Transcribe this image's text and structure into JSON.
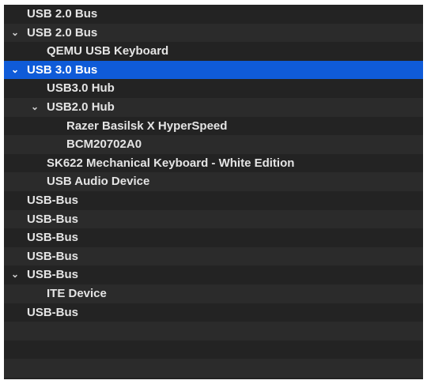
{
  "tree": {
    "rows": [
      {
        "label": "USB 2.0 Bus",
        "expanded": false
      },
      {
        "label": "USB 2.0 Bus",
        "expanded": true
      },
      {
        "label": "QEMU USB Keyboard"
      },
      {
        "label": "USB 3.0 Bus",
        "expanded": true,
        "selected": true
      },
      {
        "label": "USB3.0 Hub"
      },
      {
        "label": "USB2.0 Hub",
        "expanded": true
      },
      {
        "label": "Razer Basilsk X HyperSpeed"
      },
      {
        "label": "BCM20702A0"
      },
      {
        "label": "SK622 Mechanical Keyboard - White Edition"
      },
      {
        "label": "USB Audio Device"
      },
      {
        "label": "USB-Bus"
      },
      {
        "label": "USB-Bus"
      },
      {
        "label": "USB-Bus"
      },
      {
        "label": "USB-Bus"
      },
      {
        "label": "USB-Bus",
        "expanded": true
      },
      {
        "label": "ITE Device"
      },
      {
        "label": "USB-Bus"
      }
    ],
    "chevron_icon": "chevron-down-icon",
    "selection_color": "#0f5bd8"
  }
}
